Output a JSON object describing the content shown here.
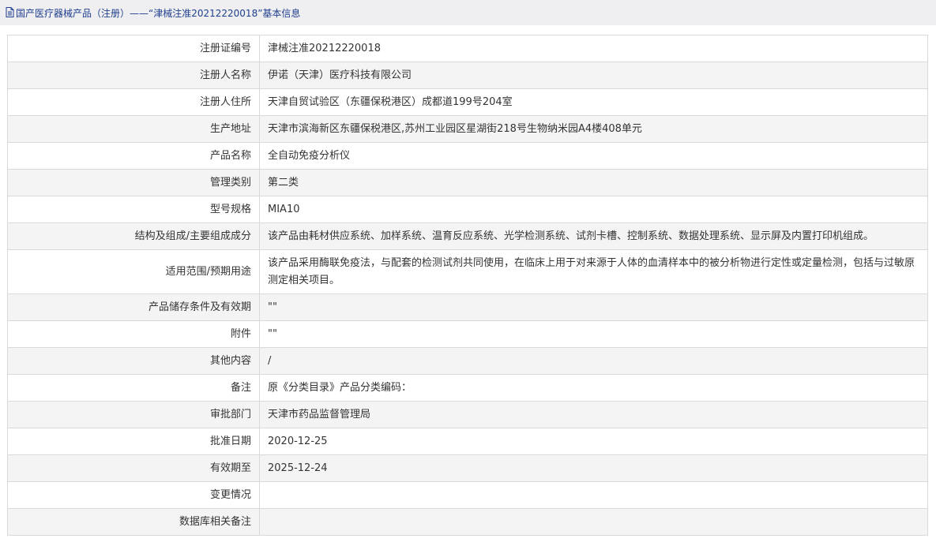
{
  "header": {
    "icon": "document-icon",
    "title": "国产医疗器械产品（注册）——“津械注准20212220018”基本信息"
  },
  "colors": {
    "title": "#1f3e8e",
    "border": "#d9d9d9",
    "stripe": "#f4f4f4",
    "header_bg": "#efeff1"
  },
  "rows": [
    {
      "label": "注册证编号",
      "value": "津械注准20212220018"
    },
    {
      "label": "注册人名称",
      "value": "伊诺（天津）医疗科技有限公司"
    },
    {
      "label": "注册人住所",
      "value": "天津自贸试验区（东疆保税港区）成都道199号204室"
    },
    {
      "label": "生产地址",
      "value": "天津市滨海新区东疆保税港区,苏州工业园区星湖街218号生物纳米园A4楼408单元"
    },
    {
      "label": "产品名称",
      "value": "全自动免疫分析仪"
    },
    {
      "label": "管理类别",
      "value": "第二类"
    },
    {
      "label": "型号规格",
      "value": "MIA10"
    },
    {
      "label": "结构及组成/主要组成成分",
      "value": "该产品由耗材供应系统、加样系统、温育反应系统、光学检测系统、试剂卡槽、控制系统、数据处理系统、显示屏及内置打印机组成。"
    },
    {
      "label": "适用范围/预期用途",
      "value": "该产品采用酶联免疫法，与配套的检测试剂共同使用，在临床上用于对来源于人体的血清样本中的被分析物进行定性或定量检测，包括与过敏原测定相关项目。"
    },
    {
      "label": "产品储存条件及有效期",
      "value": "\"\""
    },
    {
      "label": "附件",
      "value": "\"\""
    },
    {
      "label": "其他内容",
      "value": "/"
    },
    {
      "label": "备注",
      "value": "原《分类目录》产品分类编码："
    },
    {
      "label": "审批部门",
      "value": "天津市药品监督管理局"
    },
    {
      "label": "批准日期",
      "value": "2020-12-25"
    },
    {
      "label": "有效期至",
      "value": "2025-12-24"
    },
    {
      "label": "变更情况",
      "value": ""
    },
    {
      "label": "数据库相关备注",
      "value": ""
    }
  ]
}
